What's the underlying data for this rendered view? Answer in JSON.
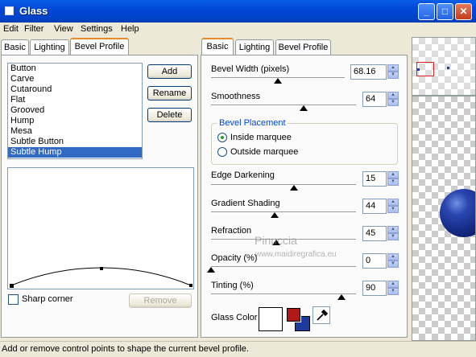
{
  "window": {
    "title": "Glass",
    "min_label": "_",
    "max_label": "□",
    "close_label": "✕"
  },
  "menu": [
    "Edit",
    "Filter",
    "View",
    "Settings",
    "Help"
  ],
  "left_tabs": [
    "Basic",
    "Lighting",
    "Bevel Profile"
  ],
  "left_active_tab": "Bevel Profile",
  "profiles": [
    "Button",
    "Carve",
    "Cutaround",
    "Flat",
    "Grooved",
    "Hump",
    "Mesa",
    "Subtle Button",
    "Subtle Hump"
  ],
  "selected_profile": "Subtle Hump",
  "buttons": {
    "add": "Add",
    "rename": "Rename",
    "delete": "Delete",
    "remove": "Remove"
  },
  "sharp_corner_label": "Sharp corner",
  "right_tabs": [
    "Basic",
    "Lighting",
    "Bevel Profile"
  ],
  "right_active_tab": "Basic",
  "settings": {
    "bevel_width": {
      "label": "Bevel Width (pixels)",
      "value": "68.16",
      "level": 0.5
    },
    "smoothness": {
      "label": "Smoothness",
      "value": "64",
      "level": 0.64
    },
    "edge_darkening": {
      "label": "Edge Darkening",
      "value": "15",
      "level": 0.57
    },
    "gradient_shading": {
      "label": "Gradient Shading",
      "value": "44",
      "level": 0.44
    },
    "refraction": {
      "label": "Refraction",
      "value": "45",
      "level": 0.45
    },
    "opacity": {
      "label": "Opacity (%)",
      "value": "0",
      "level": 0.0
    },
    "tinting": {
      "label": "Tinting (%)",
      "value": "90",
      "level": 0.9
    }
  },
  "bevel_placement": {
    "title": "Bevel Placement",
    "inside": "Inside marquee",
    "outside": "Outside marquee",
    "selected": "inside"
  },
  "glass_color_label": "Glass Color",
  "colors": {
    "glass_white": "#ffffff",
    "foreground": "#b01818",
    "background": "#1e3a9e",
    "accent_tab": "#e68b2c"
  },
  "watermark": {
    "line1": "Pinuccia",
    "line2": "www.maidiregrafica.eu"
  },
  "status": "Add or remove control points to shape the current bevel profile."
}
